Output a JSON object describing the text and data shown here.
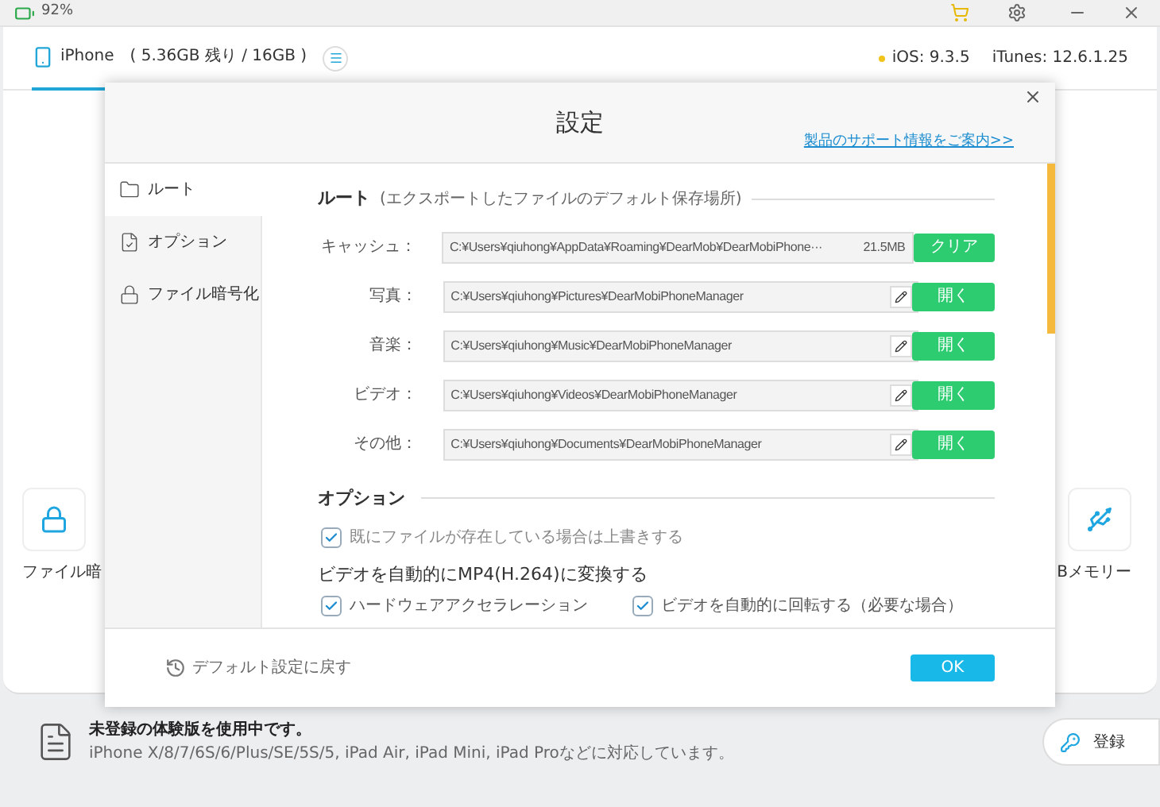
{
  "top_bar": {
    "battery": "92%"
  },
  "device": {
    "name": "iPhone",
    "storage": "( 5.36GB 残り / 16GB )",
    "ios": "iOS: 9.3.5",
    "itunes": "iTunes: 12.6.1.25"
  },
  "background_tiles": [
    {
      "label": "ファイル暗",
      "kind": "lock"
    },
    {
      "label": "Bメモリー",
      "kind": "usb"
    }
  ],
  "dialog": {
    "title": "設定",
    "support_link": "製品のサポート情報をご案内>>",
    "sidebar": [
      {
        "label": "ルート",
        "selected": true,
        "kind": "folder"
      },
      {
        "label": "オプション",
        "selected": false,
        "kind": "options"
      },
      {
        "label": "ファイル暗号化",
        "selected": false,
        "kind": "lock"
      }
    ],
    "route_section": {
      "title": "ルート",
      "hint": "(エクスポートしたファイルのデフォルト保存場所)",
      "rows": [
        {
          "label": "キャッシュ：",
          "path": "C:¥Users¥qiuhong¥AppData¥Roaming¥DearMob¥DearMobiPhone···",
          "size": "21.5MB",
          "button": "クリア",
          "kind": "cache"
        },
        {
          "label": "写真：",
          "path": "C:¥Users¥qiuhong¥Pictures¥DearMobiPhoneManager",
          "button": "開く",
          "kind": "folder"
        },
        {
          "label": "音楽：",
          "path": "C:¥Users¥qiuhong¥Music¥DearMobiPhoneManager",
          "button": "開く",
          "kind": "folder"
        },
        {
          "label": "ビデオ：",
          "path": "C:¥Users¥qiuhong¥Videos¥DearMobiPhoneManager",
          "button": "開く",
          "kind": "folder"
        },
        {
          "label": "その他：",
          "path": "C:¥Users¥qiuhong¥Documents¥DearMobiPhoneManager",
          "button": "開く",
          "kind": "folder"
        }
      ]
    },
    "options_section": {
      "title": "オプション",
      "overwrite": {
        "label": "既にファイルが存在している場合は上書きする",
        "checked": true
      },
      "convert_title": "ビデオを自動的にMP4(H.264)に変換する",
      "convert_options": [
        {
          "label": "ハードウェアアクセラレーション",
          "checked": true
        },
        {
          "label": "ビデオを自動的に回転する（必要な場合）",
          "checked": true
        }
      ]
    },
    "footer": {
      "reset": "デフォルト設定に戻す",
      "ok": "OK"
    }
  },
  "notice": {
    "title": "未登録の体験版を使用中です。",
    "text": "iPhone X/8/7/6S/6/Plus/SE/5S/5, iPad Air, iPad Mini, iPad Proなどに対応しています。"
  },
  "register_button": "登録"
}
